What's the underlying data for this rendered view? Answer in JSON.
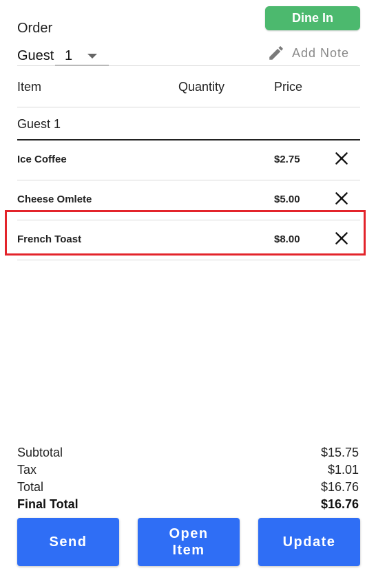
{
  "header": {
    "title": "Order",
    "dine_button": "Dine In",
    "guest_label": "Guest",
    "guest_value": "1",
    "add_note": "Add Note"
  },
  "columns": {
    "item": "Item",
    "quantity": "Quantity",
    "price": "Price"
  },
  "group_label": "Guest 1",
  "items": [
    {
      "name": "Ice Coffee",
      "price": "$2.75"
    },
    {
      "name": "Cheese Omlete",
      "price": "$5.00"
    },
    {
      "name": "French Toast",
      "price": "$8.00"
    }
  ],
  "totals": {
    "subtotal_label": "Subtotal",
    "subtotal": "$15.75",
    "tax_label": "Tax",
    "tax": "$1.01",
    "total_label": "Total",
    "total": "$16.76",
    "final_label": "Final Total",
    "final": "$16.76"
  },
  "buttons": {
    "send": "Send",
    "open_item_line1": "Open",
    "open_item_line2": "Item",
    "update": "Update"
  },
  "colors": {
    "dine_in": "#4cb96e",
    "primary": "#2f6ef5",
    "highlight": "#e3242b"
  },
  "icons": {
    "add_note": "pencil-icon",
    "remove": "close-icon",
    "dropdown": "chevron-down-icon"
  }
}
